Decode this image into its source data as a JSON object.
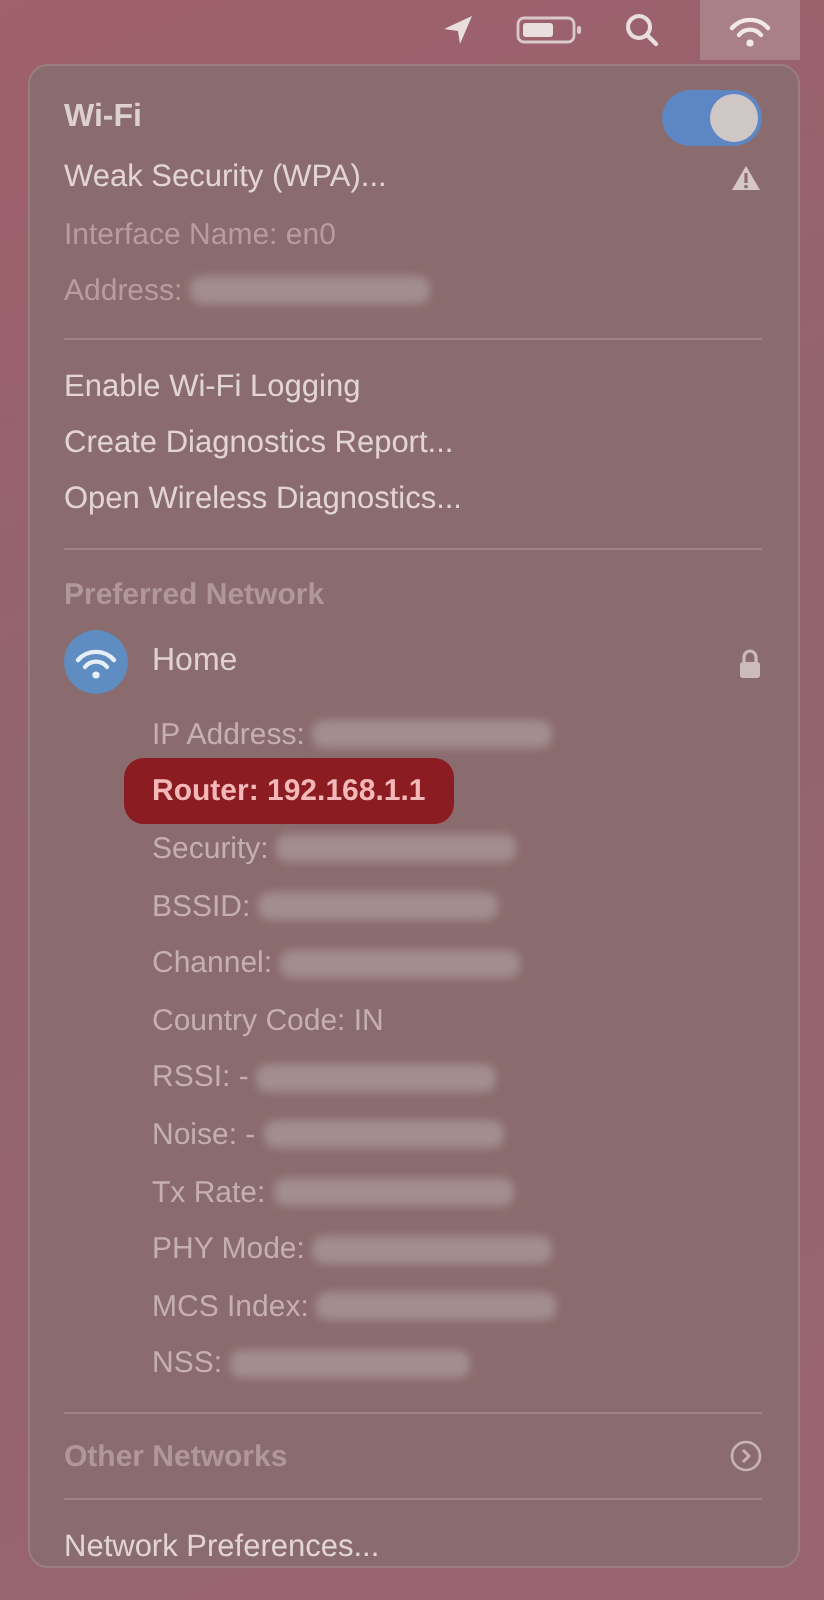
{
  "menu_bar": {
    "wifi_selected": true
  },
  "wifi": {
    "title": "Wi-Fi",
    "on": true
  },
  "status": [
    {
      "text": "Weak Security (WPA)...",
      "kind": "warning",
      "redacted": false
    },
    {
      "text": "Interface Name: en0",
      "kind": "info",
      "redacted": false
    },
    {
      "text": "Address:",
      "kind": "info",
      "redacted": true
    }
  ],
  "actions": [
    "Enable Wi-Fi Logging",
    "Create Diagnostics Report...",
    "Open Wireless Diagnostics..."
  ],
  "preferred": {
    "heading": "Preferred Network",
    "network": {
      "name": "Home",
      "locked": true
    },
    "details": [
      {
        "text": "IP Address:",
        "redacted": true,
        "highlighted": false
      },
      {
        "text": "Router: 192.168.1.1",
        "redacted": false,
        "highlighted": true
      },
      {
        "text": "Security:",
        "redacted": true,
        "highlighted": false
      },
      {
        "text": "BSSID:",
        "redacted": true,
        "highlighted": false
      },
      {
        "text": "Channel:",
        "redacted": true,
        "highlighted": false
      },
      {
        "text": "Country Code: IN",
        "redacted": false,
        "highlighted": false
      },
      {
        "text": "RSSI: -",
        "redacted": true,
        "highlighted": false
      },
      {
        "text": "Noise: -",
        "redacted": true,
        "highlighted": false
      },
      {
        "text": "Tx Rate:",
        "redacted": true,
        "highlighted": false
      },
      {
        "text": "PHY Mode:",
        "redacted": true,
        "highlighted": false
      },
      {
        "text": "MCS Index:",
        "redacted": true,
        "highlighted": false
      },
      {
        "text": "NSS:",
        "redacted": true,
        "highlighted": false
      }
    ]
  },
  "other_networks": {
    "label": "Other Networks",
    "expanded": false
  },
  "footer": "Network Preferences..."
}
